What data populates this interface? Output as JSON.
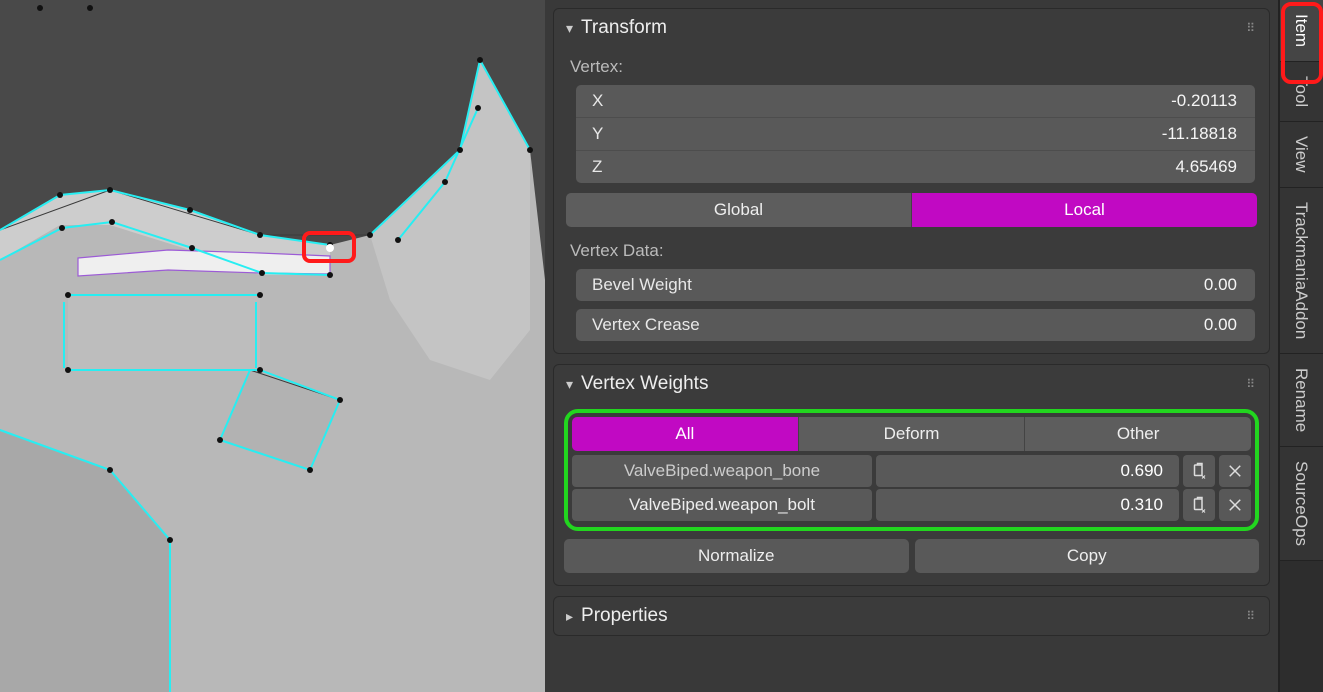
{
  "tabs": {
    "item": "Item",
    "tool": "Tool",
    "view": "View",
    "trackmania": "TrackmaniaAddon",
    "rename": "Rename",
    "sourceops": "SourceOps"
  },
  "transform": {
    "title": "Transform",
    "vertex_label": "Vertex:",
    "x_label": "X",
    "x_val": "-0.20113",
    "y_label": "Y",
    "y_val": "-11.18818",
    "z_label": "Z",
    "z_val": "4.65469",
    "global": "Global",
    "local": "Local",
    "vdata_label": "Vertex Data:",
    "bevel_label": "Bevel Weight",
    "bevel_val": "0.00",
    "crease_label": "Vertex Crease",
    "crease_val": "0.00"
  },
  "vweights": {
    "title": "Vertex Weights",
    "filter_all": "All",
    "filter_deform": "Deform",
    "filter_other": "Other",
    "groups": [
      {
        "name": "ValveBiped.weapon_bone",
        "weight": "0.690"
      },
      {
        "name": "ValveBiped.weapon_bolt",
        "weight": "0.310"
      }
    ],
    "normalize": "Normalize",
    "copy": "Copy"
  },
  "properties": {
    "title": "Properties"
  }
}
